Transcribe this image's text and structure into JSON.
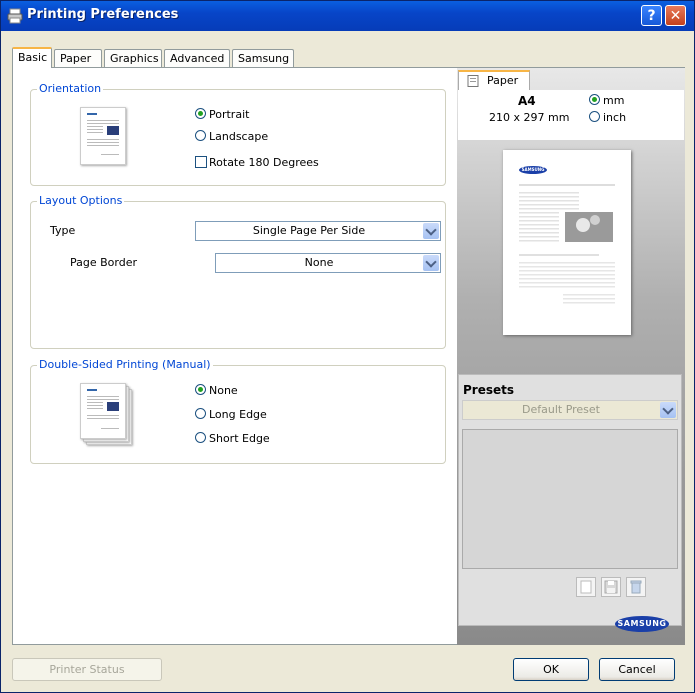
{
  "window": {
    "title": "Printing Preferences",
    "help_label": "?",
    "close_label": "✕"
  },
  "tabs": [
    {
      "label": "Basic"
    },
    {
      "label": "Paper"
    },
    {
      "label": "Graphics"
    },
    {
      "label": "Advanced"
    },
    {
      "label": "Samsung"
    }
  ],
  "orientation": {
    "title": "Orientation",
    "options": [
      {
        "label": "Portrait",
        "selected": true
      },
      {
        "label": "Landscape",
        "selected": false
      }
    ],
    "rotate_label": "Rotate 180 Degrees",
    "rotate_checked": false
  },
  "layout": {
    "title": "Layout Options",
    "type_label": "Type",
    "type_value": "Single Page Per Side",
    "border_label": "Page Border",
    "border_value": "None"
  },
  "duplex": {
    "title": "Double-Sided Printing (Manual)",
    "options": [
      {
        "label": "None",
        "selected": true
      },
      {
        "label": "Long Edge",
        "selected": false
      },
      {
        "label": "Short Edge",
        "selected": false
      }
    ]
  },
  "preview": {
    "tab_label": "Paper",
    "size_name": "A4",
    "size_dims": "210 x 297 mm",
    "unit_mm": "mm",
    "unit_inch": "inch",
    "unit_selected": "mm",
    "page_logo": "SAMSUNG"
  },
  "presets": {
    "title": "Presets",
    "value": "Default Preset"
  },
  "brand": {
    "logo": "SAMSUNG"
  },
  "buttons": {
    "printer_status": "Printer Status",
    "ok": "OK",
    "cancel": "Cancel"
  }
}
